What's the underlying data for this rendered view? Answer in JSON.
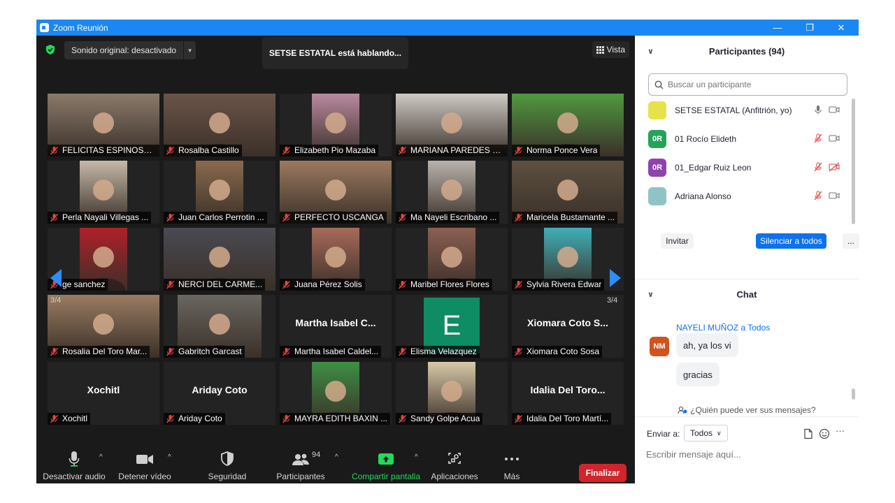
{
  "window": {
    "title": "Zoom Reunión",
    "minimize": "—",
    "restore": "❐",
    "close": "✕"
  },
  "topbar": {
    "sound_label": "Sonido original: desactivado",
    "speaking": "SETSE ESTATAL está hablando...",
    "view_label": "Vista"
  },
  "pager": {
    "prev": "3/4",
    "next": "3/4"
  },
  "tiles": [
    {
      "name": "FELICITAS ESPINOSA ...",
      "kind": "photo",
      "color": "#8a7a6a"
    },
    {
      "name": "Rosalba Castillo",
      "kind": "photo",
      "color": "#6b5448"
    },
    {
      "name": "Elizabeth Pio Mazaba",
      "kind": "photo",
      "color": "#b98aa0"
    },
    {
      "name": "MARIANA PAREDES G...",
      "kind": "photo",
      "color": "#cfcac5"
    },
    {
      "name": "Norma Ponce Vera",
      "kind": "photo",
      "color": "#4f9a3f"
    },
    {
      "name": "Perla Nayali Villegas ...",
      "kind": "photo",
      "color": "#c7b9a8"
    },
    {
      "name": "Juan Carlos Perrotin ...",
      "kind": "photo",
      "color": "#8a6a4c"
    },
    {
      "name": "PERFECTO USCANGA",
      "kind": "photo",
      "color": "#9b7a5e"
    },
    {
      "name": "Ma Nayeli Escribano ...",
      "kind": "photo",
      "color": "#b9b2ac"
    },
    {
      "name": "Maricela Bustamante ...",
      "kind": "photo",
      "color": "#5e5040"
    },
    {
      "name": "ge sanchez",
      "kind": "photo",
      "color": "#b0202a"
    },
    {
      "name": "NERCI  DEL  CARME...",
      "kind": "photo",
      "color": "#4a4a52"
    },
    {
      "name": "Juana Pérez Solis",
      "kind": "photo",
      "color": "#a86a5a"
    },
    {
      "name": "Maribel Flores Flores",
      "kind": "photo",
      "color": "#8c5f52"
    },
    {
      "name": "Sylvia Rivera Edwar",
      "kind": "photo",
      "color": "#3fb0b8"
    },
    {
      "name": "Rosalia Del Toro Mar...",
      "kind": "photo",
      "color": "#9a7c62"
    },
    {
      "name": "Gabritch Garcast",
      "kind": "photo",
      "color": "#6a6660"
    },
    {
      "name": "Martha Isabel Caldel...",
      "kind": "text",
      "title": "Martha Isabel C..."
    },
    {
      "name": "Elisma Velazquez",
      "kind": "letter",
      "letter": "E"
    },
    {
      "name": "Xiomara Coto Sosa",
      "kind": "text",
      "title": "Xiomara Coto S..."
    },
    {
      "name": "Xochitl",
      "kind": "text",
      "title": "Xochitl"
    },
    {
      "name": "Ariday Coto",
      "kind": "text",
      "title": "Ariday Coto"
    },
    {
      "name": "MAYRA EDITH BAXIN ...",
      "kind": "photo",
      "color": "#3e8f44"
    },
    {
      "name": "Sandy Golpe Acua",
      "kind": "photo",
      "color": "#d8c9a8"
    },
    {
      "name": "Idalia Del Toro Martí...",
      "kind": "text",
      "title": "Idalia Del Toro..."
    }
  ],
  "toolbar": {
    "audio": "Desactivar audio",
    "video": "Detener vídeo",
    "security": "Seguridad",
    "participants": "Participantes",
    "participants_count": "94",
    "share": "Compartir pantalla",
    "apps": "Aplicaciones",
    "more": "Más",
    "end": "Finalizar"
  },
  "participants": {
    "header": "Participantes (94)",
    "search_placeholder": "Buscar un participante",
    "list": [
      {
        "name": "SETSE ESTATAL (Anfitrión, yo)",
        "initials": "",
        "color": "#e8e24a"
      },
      {
        "name": "01 Rocío Elideth",
        "initials": "0R",
        "color": "#25a35a"
      },
      {
        "name": "01_Edgar Ruiz Leon",
        "initials": "0R",
        "color": "#8e44ad"
      },
      {
        "name": "Adriana Alonso",
        "initials": "",
        "color": "#8fc3c8"
      }
    ],
    "invite": "Invitar",
    "mute_all": "Silenciar a todos",
    "more": "..."
  },
  "chat": {
    "header": "Chat",
    "sender": "NAYELI MUÑOZ a Todos",
    "sender_initials": "NM",
    "messages": [
      "ah, ya los vi",
      "gracias"
    ],
    "who_can_see": "¿Quién puede ver sus mensajes?",
    "send_to_label": "Enviar a:",
    "send_to_value": "Todos",
    "input_placeholder": "Escribir mensaje aquí...",
    "tools_more": "···"
  }
}
